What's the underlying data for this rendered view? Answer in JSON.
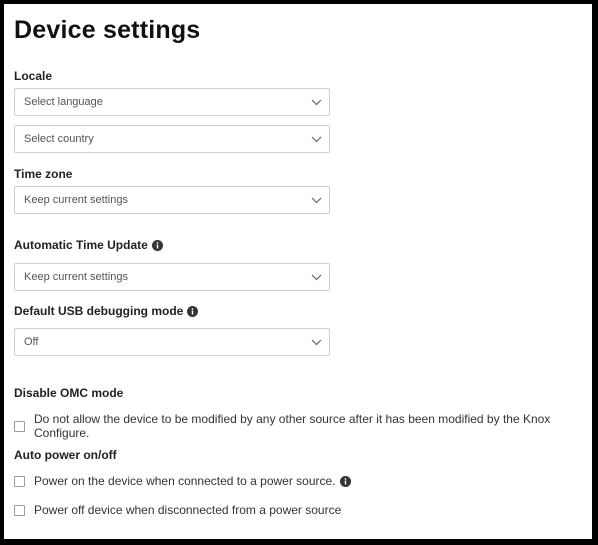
{
  "title": "Device settings",
  "locale": {
    "label": "Locale",
    "language_value": "Select language",
    "country_value": "Select country"
  },
  "time_zone": {
    "label": "Time zone",
    "value": "Keep current settings"
  },
  "auto_time_update": {
    "label": "Automatic Time Update",
    "value": "Keep current settings"
  },
  "usb_debugging": {
    "label": "Default USB debugging mode",
    "value": "Off"
  },
  "omc_mode": {
    "label": "Disable OMC mode",
    "option": "Do not allow the device to be modified by any other source after it has been modified by the Knox Configure."
  },
  "auto_power": {
    "label": "Auto power on/off",
    "power_on_option": "Power on the device when connected to a power source.",
    "power_off_option": "Power off device when disconnected from a power source"
  },
  "icons": {
    "info": "info-icon",
    "dropdown": "chevron-down-icon"
  }
}
